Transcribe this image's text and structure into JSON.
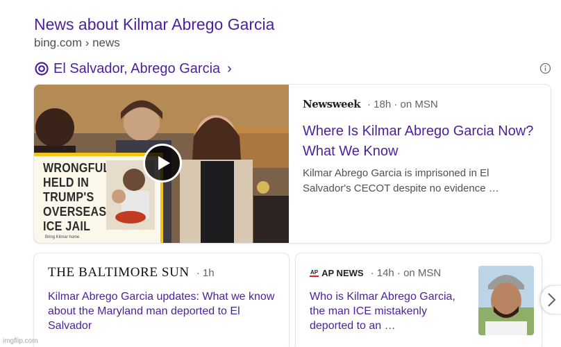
{
  "header": {
    "title": "News about Kilmar Abrego Garcia",
    "breadcrumb": "bing.com › news"
  },
  "topic": {
    "label": "El Salvador, Abrego Garcia",
    "chevron": "›",
    "icon": "topic-ring-icon",
    "info_icon": "info-icon"
  },
  "main_story": {
    "source": "Newsweek",
    "meta": "· 18h · on MSN",
    "headline": "Where Is Kilmar Abrego Garcia Now? What We Know",
    "snippet": "Kilmar Abrego Garcia is imprisoned in El Salvador's CECOT despite no evidence …",
    "sign_lines": [
      "WRONGFULLY",
      "HELD IN",
      "TRUMP'S",
      "OVERSEAS",
      "ICE JAIL"
    ],
    "sign_footer": "Bring Kilmar home",
    "has_video": true
  },
  "stories": [
    {
      "source": "THE BALTIMORE SUN",
      "meta": "· 1h",
      "headline": "Kilmar Abrego Garcia updates: What we know about the Maryland man deported to El Salvador"
    },
    {
      "source_mark": "AP",
      "source": "AP NEWS",
      "meta": "· 14h · on MSN",
      "headline": "Who is Kilmar Abrego Garcia, the man ICE mistakenly deported to an …"
    }
  ],
  "watermark": "imgflip.com",
  "colors": {
    "link": "#4b1f9e",
    "meta": "#5f6368",
    "sign_border": "#f2c418"
  }
}
